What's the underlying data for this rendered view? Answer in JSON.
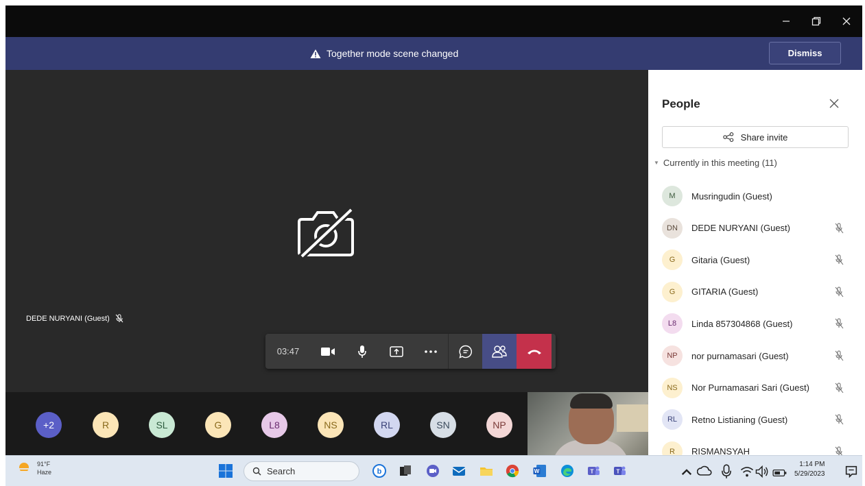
{
  "window": {
    "minimize_label": "Minimize",
    "restore_label": "Restore",
    "close_label": "Close"
  },
  "banner": {
    "message": "Together mode scene changed",
    "dismiss_label": "Dismiss"
  },
  "stage": {
    "participant_label": "DEDE NURYANI (Guest)"
  },
  "controls": {
    "timer": "03:47"
  },
  "roster_strip": [
    {
      "initials": "+2",
      "color": "#5b5fc7",
      "text_color": "#ffffff"
    },
    {
      "initials": "R",
      "color": "#fbe5b7",
      "text_color": "#8a6a1c"
    },
    {
      "initials": "SL",
      "color": "#c9e9d4",
      "text_color": "#2e5d3f"
    },
    {
      "initials": "G",
      "color": "#fbe5b7",
      "text_color": "#8a6a1c"
    },
    {
      "initials": "L8",
      "color": "#e7c9e8",
      "text_color": "#6a2c6f"
    },
    {
      "initials": "NS",
      "color": "#fbe5b7",
      "text_color": "#8a6a1c"
    },
    {
      "initials": "RL",
      "color": "#d2d7f0",
      "text_color": "#3a4279"
    },
    {
      "initials": "SN",
      "color": "#d7dee6",
      "text_color": "#3a4a5c"
    },
    {
      "initials": "NP",
      "color": "#f3d7d6",
      "text_color": "#7a3a38"
    }
  ],
  "people_panel": {
    "title": "People",
    "share_invite_label": "Share invite",
    "section_label": "Currently in this meeting (11)",
    "people": [
      {
        "initials": "M",
        "name": "Musringudin (Guest)",
        "color": "#dde7dd",
        "text_color": "#3c5a3c",
        "muted": false
      },
      {
        "initials": "DN",
        "name": "DEDE NURYANI (Guest)",
        "color": "#e9e2dc",
        "text_color": "#5a4a3c",
        "muted": true
      },
      {
        "initials": "G",
        "name": "Gitaria (Guest)",
        "color": "#fdf0cf",
        "text_color": "#8a6a1c",
        "muted": true
      },
      {
        "initials": "G",
        "name": "GITARIA (Guest)",
        "color": "#fdf0cf",
        "text_color": "#8a6a1c",
        "muted": true
      },
      {
        "initials": "L8",
        "name": "Linda 857304868 (Guest)",
        "color": "#f3dcef",
        "text_color": "#6a2c6f",
        "muted": true
      },
      {
        "initials": "NP",
        "name": "nor purnamasari (Guest)",
        "color": "#f6e2e0",
        "text_color": "#7a3a38",
        "muted": true
      },
      {
        "initials": "NS",
        "name": "Nor Purnamasari Sari (Guest)",
        "color": "#fdf0cf",
        "text_color": "#8a6a1c",
        "muted": true
      },
      {
        "initials": "RL",
        "name": "Retno Listianing (Guest)",
        "color": "#e2e5f5",
        "text_color": "#3a4279",
        "muted": true
      },
      {
        "initials": "R",
        "name": "RISMANSYAH",
        "color": "#fdf0cf",
        "text_color": "#8a6a1c",
        "muted": true
      }
    ]
  },
  "taskbar": {
    "weather_temp": "91°F",
    "weather_desc": "Haze",
    "search_label": "Search",
    "time": "1:14 PM",
    "date": "5/29/2023"
  }
}
